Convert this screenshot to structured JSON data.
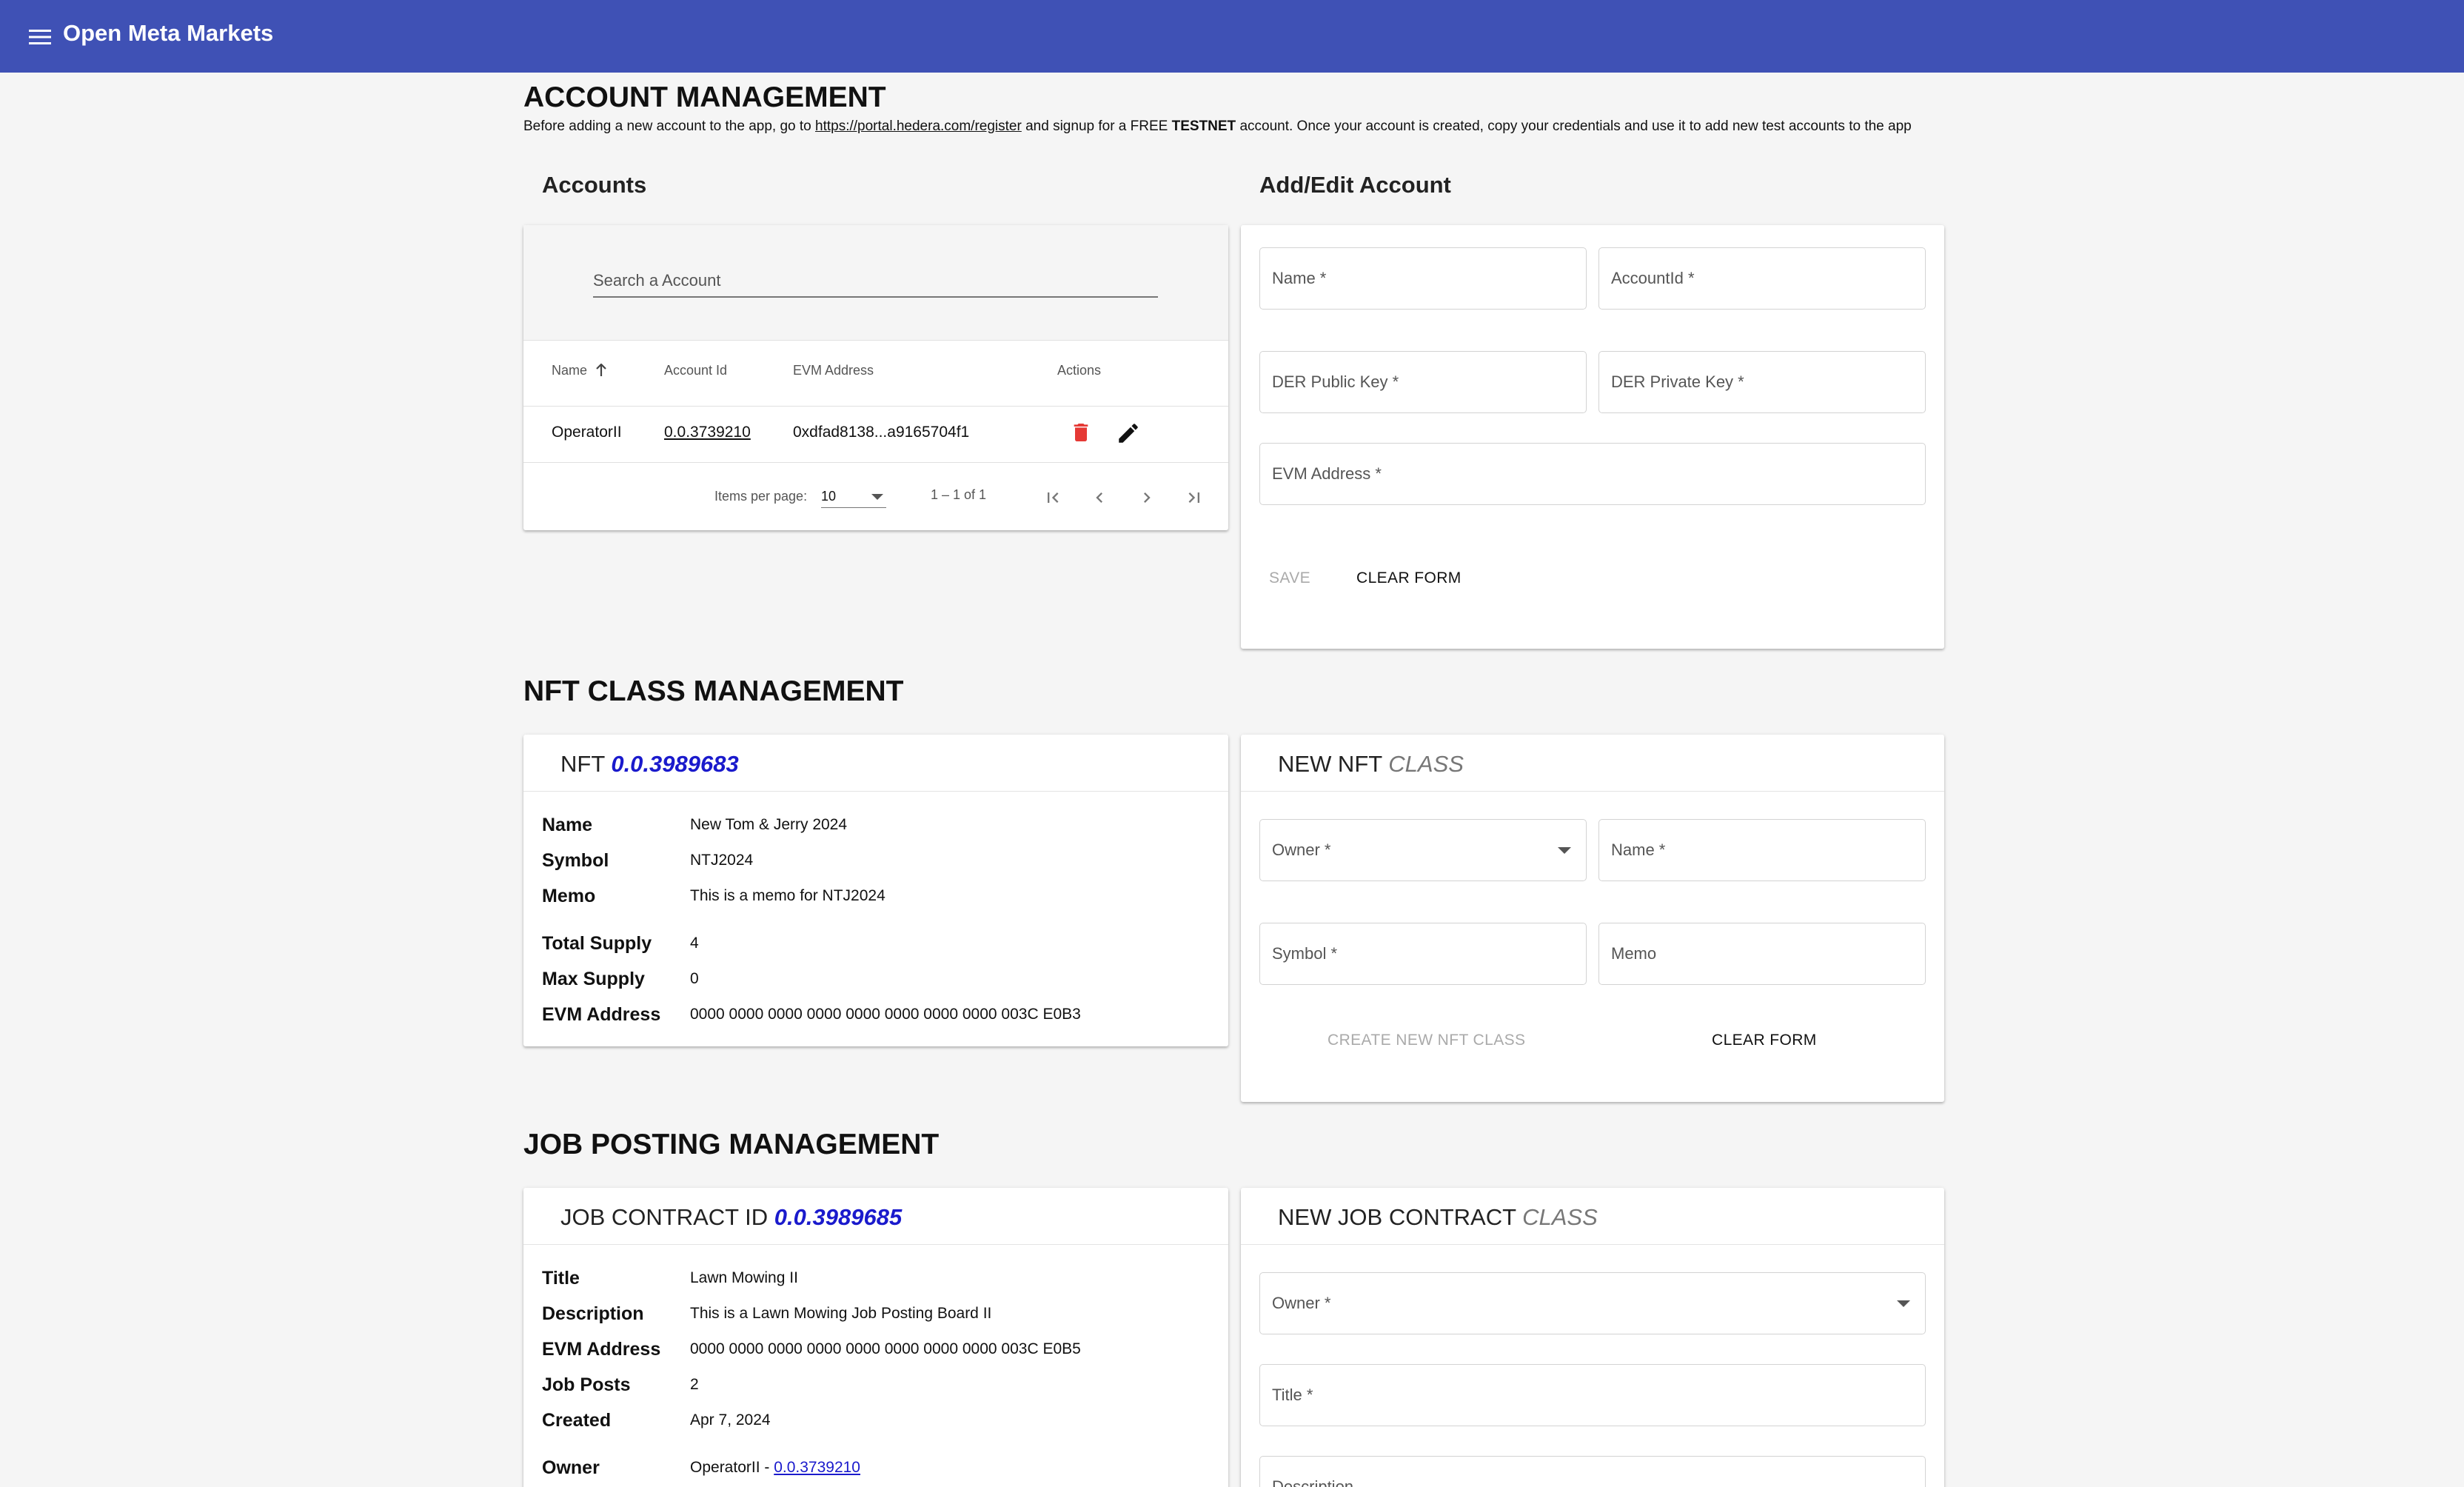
{
  "app": {
    "title": "Open Meta Markets"
  },
  "account_section": {
    "heading": "ACCOUNT MANAGEMENT",
    "intro_before": "Before adding a new account to the app, go to ",
    "intro_link": "https://portal.hedera.com/register",
    "intro_middle": " and signup for a FREE ",
    "intro_bold": "TESTNET",
    "intro_after": " account. Once your account is created, copy your credentials and use it to add new test accounts to the app"
  },
  "accounts": {
    "heading": "Accounts",
    "search_placeholder": "Search a Account",
    "columns": [
      "Name",
      "Account Id",
      "EVM Address",
      "Actions"
    ],
    "rows": [
      {
        "name": "OperatorII",
        "account_id": "0.0.3739210",
        "evm": "0xdfad8138...a9165704f1"
      }
    ],
    "pagination": {
      "items_label": "Items per page:",
      "page_size": "10",
      "range": "1 – 1 of 1"
    }
  },
  "add_edit": {
    "heading": "Add/Edit Account",
    "fields": {
      "name": "Name *",
      "account_id": "AccountId *",
      "der_public": "DER Public Key *",
      "der_private": "DER Private Key *",
      "evm": "EVM Address *"
    },
    "save": "SAVE",
    "clear": "CLEAR FORM"
  },
  "nft_section": {
    "heading": "NFT CLASS MANAGEMENT"
  },
  "nft_card": {
    "title_prefix": "NFT",
    "title_id": "0.0.3989683",
    "rows": [
      {
        "label": "Name",
        "value": "New Tom & Jerry 2024"
      },
      {
        "label": "Symbol",
        "value": "NTJ2024"
      },
      {
        "label": "Memo",
        "value": "This is a memo for NTJ2024"
      },
      {
        "label": "Total Supply",
        "value": "4"
      },
      {
        "label": "Max Supply",
        "value": "0"
      },
      {
        "label": "EVM Address",
        "value": "0000 0000 0000 0000 0000 0000 0000 0000 003C E0B3"
      }
    ]
  },
  "new_nft": {
    "title_main": "NEW NFT",
    "title_muted": "CLASS",
    "fields": {
      "owner": "Owner *",
      "name": "Name *",
      "symbol": "Symbol *",
      "memo": "Memo"
    },
    "create": "CREATE NEW NFT CLASS",
    "clear": "CLEAR FORM"
  },
  "job_section": {
    "heading": "JOB POSTING MANAGEMENT"
  },
  "job_card": {
    "title_prefix": "JOB CONTRACT ID",
    "title_id": "0.0.3989685",
    "rows": [
      {
        "label": "Title",
        "value": "Lawn Mowing II"
      },
      {
        "label": "Description",
        "value": "This is a Lawn Mowing Job Posting Board II"
      },
      {
        "label": "EVM Address",
        "value": "0000 0000 0000 0000 0000 0000 0000 0000 003C E0B5"
      },
      {
        "label": "Job Posts",
        "value": "2"
      },
      {
        "label": "Created",
        "value": "Apr 7, 2024"
      }
    ],
    "owner_label": "Owner",
    "owner_name": "OperatorII - ",
    "owner_link": "0.0.3739210"
  },
  "new_job": {
    "title_main": "NEW JOB CONTRACT",
    "title_muted": "CLASS",
    "fields": {
      "owner": "Owner *",
      "title": "Title *",
      "description": "Description"
    }
  }
}
